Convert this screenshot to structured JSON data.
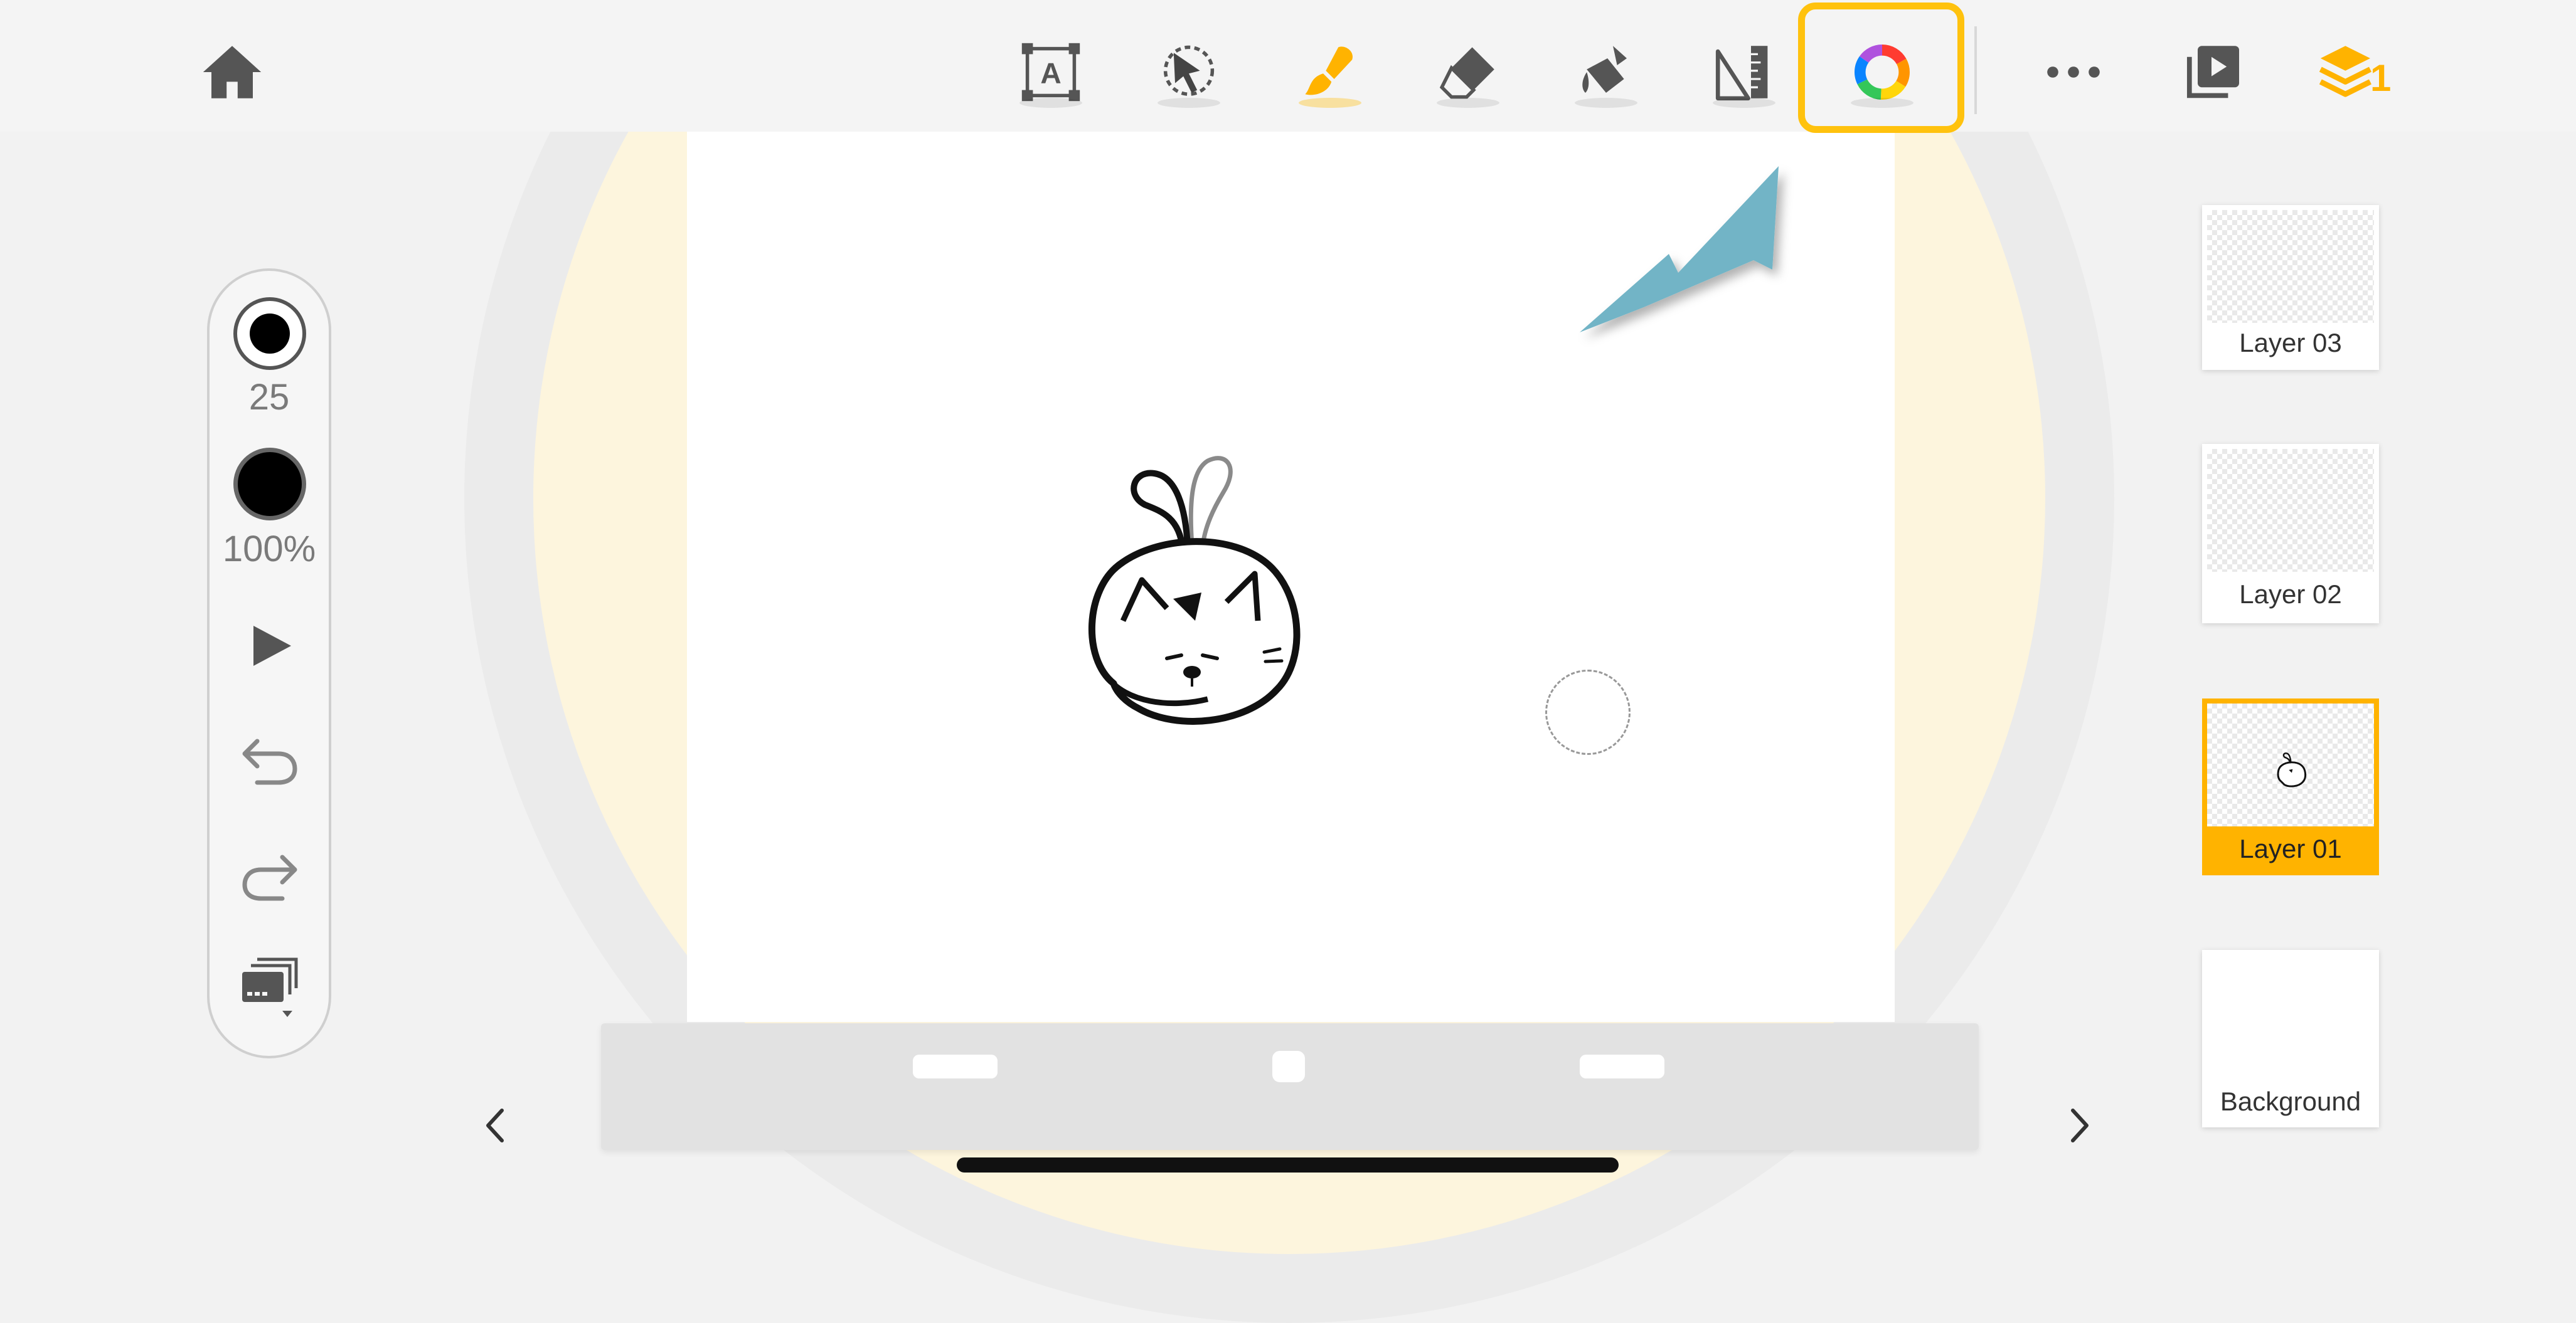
{
  "toolbar": {
    "home": "home-icon",
    "tools": [
      {
        "name": "text-tool-icon"
      },
      {
        "name": "selection-tool-icon"
      },
      {
        "name": "brush-tool-icon",
        "active": true
      },
      {
        "name": "eraser-tool-icon"
      },
      {
        "name": "fill-tool-icon"
      },
      {
        "name": "ruler-tool-icon"
      },
      {
        "name": "color-wheel-icon",
        "highlighted": true
      }
    ],
    "more": "more-icon",
    "playback": "playback-icon",
    "layers_count": "1",
    "highlight_color": "#ffc20e",
    "accent_color": "#ffb300"
  },
  "side_panel": {
    "brush_size": "25",
    "opacity": "100%"
  },
  "layers": [
    {
      "label": "Layer 03"
    },
    {
      "label": "Layer 02"
    },
    {
      "label": "Layer 01",
      "selected": true
    },
    {
      "label": "Background"
    }
  ],
  "annotation": {
    "arrow_color": "#72b4c6"
  }
}
